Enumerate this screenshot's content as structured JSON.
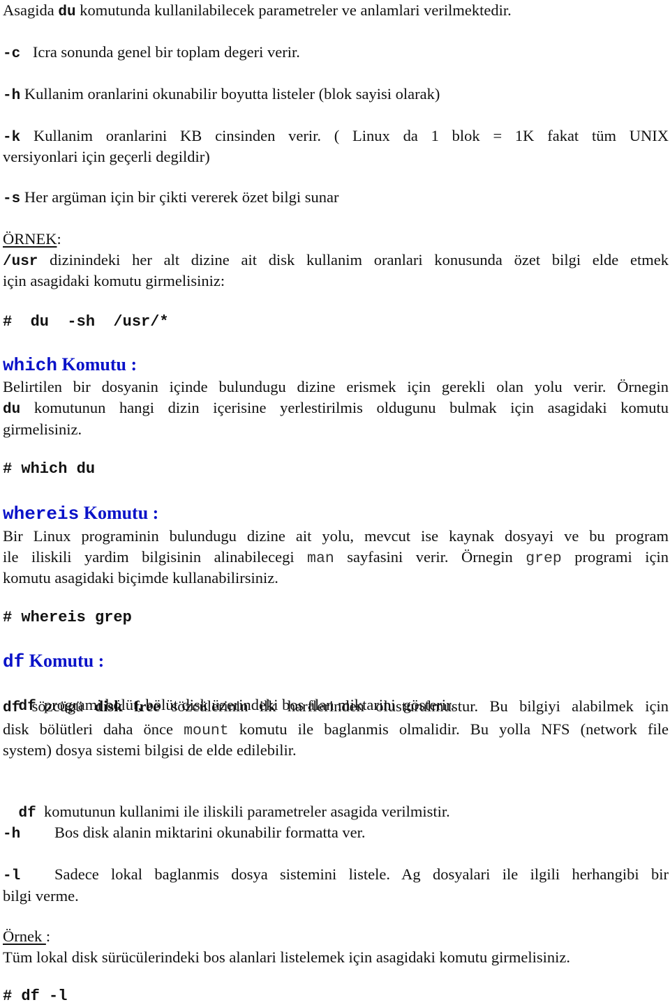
{
  "du_params": {
    "intro": {
      "pre": "Asagida ",
      "cmd": "du",
      "post": " komutunda kullanilabilecek parametreler ve anlamlari verilmektedir."
    },
    "items": [
      {
        "flag": "-c",
        "text": " Icra sonunda genel bir toplam degeri verir."
      },
      {
        "flag": "-h",
        "text": "Kullanim oranlarini okunabilir boyutta listeler (blok sayisi olarak)"
      },
      {
        "flag": "-k",
        "text": "Kullanim oranlarini KB cinsinden verir. ( Linux da 1 blok = 1K fakat tüm UNIX",
        "text_cont": "versiyonlari için geçerli degildir)"
      },
      {
        "flag": "-s",
        "text": "Her argüman için bir çikti vererek özet bilgi sunar"
      }
    ],
    "example": {
      "label": "ÖRNEK",
      "colon": ":",
      "path": "/usr",
      "line1": " dizinindeki her alt dizine ait disk kullanim oranlari konusunda özet bilgi elde etmek",
      "line2": "için asagidaki komutu girmelisiniz:",
      "command": "#  du  -sh  /usr/*"
    }
  },
  "which": {
    "heading_cmd": "which",
    "heading_text": " Komutu :",
    "line1": "Belirtilen bir dosyanin içinde bulundugu dizine erismek için gerekli olan yolu verir. Örnegin",
    "line2_cmd": "du",
    "line2": " komutunun hangi dizin içerisine yerlestirilmis oldugunu bulmak için asagidaki komutu",
    "line3": "girmelisiniz.",
    "command": "# which du"
  },
  "whereis": {
    "heading_cmd": "whereis",
    "heading_text": " Komutu :",
    "line1": "Bir Linux programinin bulundugu dizine ait yolu, mevcut ise kaynak dosyayi ve bu program",
    "line2_pre": "ile iliskili yardim bilgisinin alinabilecegi ",
    "line2_code1": "man",
    "line2_mid": " sayfasini verir. Örnegin ",
    "line2_code2": "grep",
    "line2_post": " programi için",
    "line3": "komutu asagidaki biçimde kullanabilirsiniz.",
    "command": "# whereis grep"
  },
  "df": {
    "heading_cmd": "df",
    "heading_text": " Komutu :",
    "cmd": "df",
    "line1": " programi bölüt, bölüt disk üzerindeki bos alan miktarini  gösterir.",
    "line2_pre": " sözcügü ",
    "line2_bold": "disk free",
    "line2_post": " sözcülerinin ilk harflerinden olusturulmustur. Bu bilgiyi alabilmek için",
    "line3_pre": "disk bölütleri daha önce ",
    "line3_code": "mount",
    "line3_post": " komutu ile baglanmis olmalidir. Bu yolla NFS (network file",
    "line4": "system) dosya sistemi bilgisi de elde edilebilir.",
    "params_intro": " komutunun kullanimi ile iliskili parametreler asagida verilmistir.",
    "params": [
      {
        "flag": "-h",
        "text": "Bos disk alanin miktarini okunabilir formatta ver."
      },
      {
        "flag": "-l",
        "text": "Sadece lokal baglanmis dosya sistemini listele. Ag dosyalari ile ilgili herhangibi bir",
        "text_cont": "bilgi verme."
      }
    ],
    "example": {
      "label": "Örnek ",
      "colon": ":",
      "text": "Tüm lokal disk sürücülerindeki bos alanlari listelemek için asagidaki komutu girmelisiniz.",
      "command": "# df -l"
    }
  }
}
